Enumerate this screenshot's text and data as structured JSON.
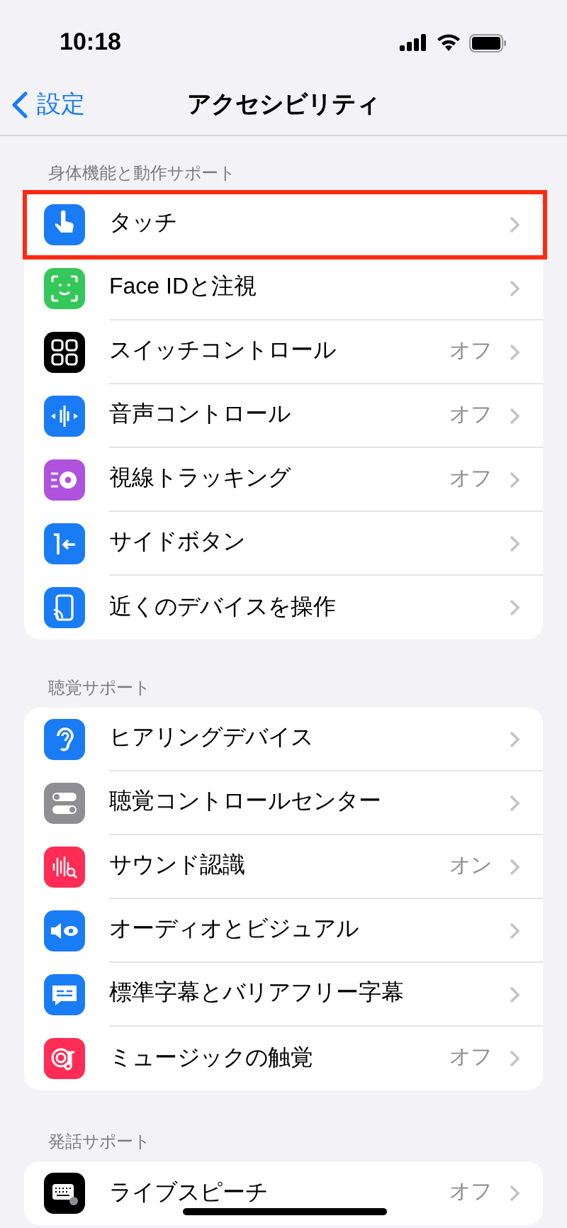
{
  "status_bar": {
    "time": "10:18"
  },
  "nav": {
    "back": "設定",
    "title": "アクセシビリティ"
  },
  "sections": [
    {
      "header": "身体機能と動作サポート",
      "items": [
        {
          "label": "タッチ",
          "highlighted": true
        },
        {
          "label": "Face IDと注視",
          "highlighted": false
        },
        {
          "label": "スイッチコントロール",
          "value": "オフ",
          "highlighted": false
        },
        {
          "label": "音声コントロール",
          "value": "オフ",
          "highlighted": false
        },
        {
          "label": "視線トラッキング",
          "value": "オフ",
          "highlighted": false
        },
        {
          "label": "サイドボタン",
          "highlighted": false
        },
        {
          "label": "近くのデバイスを操作",
          "highlighted": false
        }
      ]
    },
    {
      "header": "聴覚サポート",
      "items": [
        {
          "label": "ヒアリングデバイス",
          "highlighted": false
        },
        {
          "label": "聴覚コントロールセンター",
          "highlighted": false
        },
        {
          "label": "サウンド認識",
          "value": "オン",
          "highlighted": false
        },
        {
          "label": "オーディオとビジュアル",
          "highlighted": false
        },
        {
          "label": "標準字幕とバリアフリー字幕",
          "highlighted": false
        },
        {
          "label": "ミュージックの触覚",
          "value": "オフ",
          "highlighted": false
        }
      ]
    },
    {
      "header": "発話サポート",
      "items": [
        {
          "label": "ライブスピーチ",
          "value": "オフ",
          "highlighted": false
        }
      ]
    }
  ]
}
